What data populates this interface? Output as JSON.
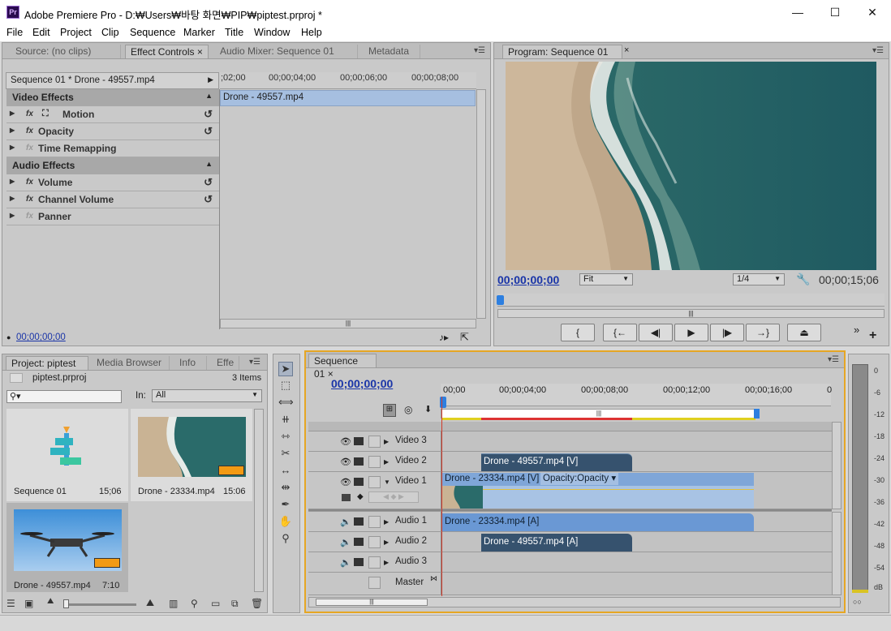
{
  "window": {
    "app_icon": "Pr",
    "title": "Adobe Premiere Pro - D:₩Users₩바탕 화면₩PIP₩piptest.prproj *",
    "controls": [
      "minimize-icon",
      "maximize-icon",
      "close-icon"
    ]
  },
  "menu": [
    "File",
    "Edit",
    "Project",
    "Clip",
    "Sequence",
    "Marker",
    "Title",
    "Window",
    "Help"
  ],
  "source_panel": {
    "tabs": [
      "Source: (no clips)",
      "Effect Controls",
      "Audio Mixer: Sequence 01",
      "Metadata"
    ],
    "active_tab": "Effect Controls",
    "clip_header": "Sequence 01 * Drone - 49557.mp4",
    "ruler": [
      ";02;00",
      "00;00;04;00",
      "00;00;06;00",
      "00;00;08;00"
    ],
    "clip_bar": "Drone - 49557.mp4",
    "video_effects_label": "Video Effects",
    "audio_effects_label": "Audio Effects",
    "effects": [
      {
        "name": "Motion",
        "fx": "fx",
        "reset": true
      },
      {
        "name": "Opacity",
        "fx": "fx",
        "reset": true
      },
      {
        "name": "Time Remapping",
        "fx": "fx",
        "reset": false
      }
    ],
    "audio_effects": [
      {
        "name": "Volume",
        "fx": "fx",
        "reset": true
      },
      {
        "name": "Channel Volume",
        "fx": "fx",
        "reset": true
      },
      {
        "name": "Panner",
        "fx": "fx",
        "reset": false
      }
    ],
    "timecode": "00;00;00;00"
  },
  "program_panel": {
    "tab": "Program: Sequence 01",
    "timecode": "00;00;00;00",
    "fit": "Fit",
    "resolution": "1/4",
    "duration": "00;00;15;06",
    "transport": [
      "mark-in",
      "go-to-in",
      "step-back",
      "play",
      "step-forward",
      "go-to-out",
      "lift"
    ]
  },
  "project_panel": {
    "tabs": [
      "Project: piptest",
      "Media Browser",
      "Info",
      "Effe"
    ],
    "project_file": "piptest.prproj",
    "item_count": "3 Items",
    "in_label": "In:",
    "in_value": "All",
    "items": [
      {
        "name": "Sequence 01",
        "duration": "15;06"
      },
      {
        "name": "Drone - 23334.mp4",
        "duration": "15:06"
      },
      {
        "name": "Drone - 49557.mp4",
        "duration": "7:10"
      }
    ]
  },
  "timeline": {
    "tab": "Sequence 01",
    "timecode": "00;00;00;00",
    "ruler": [
      "00;00",
      "00;00;04;00",
      "00;00;08;00",
      "00;00;12;00",
      "00;00;16;00",
      "0"
    ],
    "tracks": [
      {
        "name": "Video 3"
      },
      {
        "name": "Video 2"
      },
      {
        "name": "Video 1"
      },
      {
        "name": "Audio 1"
      },
      {
        "name": "Audio 2"
      },
      {
        "name": "Audio 3"
      },
      {
        "name": "Master"
      }
    ],
    "clips": {
      "v2": "Drone - 49557.mp4 [V]",
      "v1": "Drone - 23334.mp4 [V]",
      "v1_fx": "Opacity:Opacity",
      "a1": "Drone - 23334.mp4 [A]",
      "a2": "Drone - 49557.mp4 [A]"
    }
  },
  "audio_meter": {
    "labels": [
      "0",
      "-6",
      "-12",
      "-18",
      "-24",
      "-30",
      "-36",
      "-42",
      "-48",
      "-54",
      "dB"
    ]
  }
}
